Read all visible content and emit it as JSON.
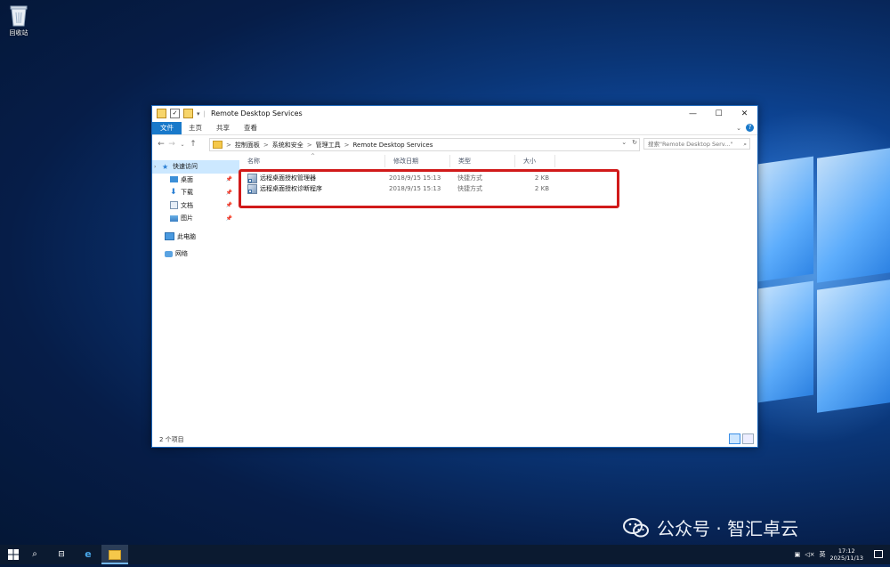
{
  "desktop": {
    "recycle_bin_label": "回收站"
  },
  "window": {
    "title": "Remote Desktop Services",
    "controls": {
      "minimize": "—",
      "maximize": "☐",
      "close": "✕"
    }
  },
  "ribbon": {
    "tabs": [
      "文件",
      "主页",
      "共享",
      "查看"
    ]
  },
  "navigation": {
    "up_arrow": "↑",
    "breadcrumbs": [
      "控制面板",
      "系统和安全",
      "管理工具",
      "Remote Desktop Services"
    ],
    "search_placeholder": "搜索\"Remote Desktop Serv...\""
  },
  "nav_pane": {
    "items": [
      {
        "label": "快速访问",
        "icon": "star-icon",
        "pinned": false
      },
      {
        "label": "桌面",
        "icon": "desktop-icon",
        "pinned": true
      },
      {
        "label": "下载",
        "icon": "download-icon",
        "pinned": true
      },
      {
        "label": "文档",
        "icon": "document-icon",
        "pinned": true
      },
      {
        "label": "图片",
        "icon": "picture-icon",
        "pinned": true
      },
      {
        "label": "此电脑",
        "icon": "computer-icon",
        "pinned": false
      },
      {
        "label": "网络",
        "icon": "network-icon",
        "pinned": false
      }
    ]
  },
  "file_list": {
    "columns": [
      "名称",
      "修改日期",
      "类型",
      "大小"
    ],
    "rows": [
      {
        "name": "远程桌面授权管理器",
        "modified": "2018/9/15 15:13",
        "type": "快捷方式",
        "size": "2 KB"
      },
      {
        "name": "远程桌面授权诊断程序",
        "modified": "2018/9/15 15:13",
        "type": "快捷方式",
        "size": "2 KB"
      }
    ]
  },
  "status": {
    "item_count": "2 个项目"
  },
  "taskbar": {
    "time": "17:12",
    "date": "2025/11/13",
    "ime": "英"
  },
  "watermark": {
    "text": "公众号 · 智汇卓云"
  },
  "colors": {
    "accent": "#1979ca",
    "highlight_border": "#d11a1a"
  }
}
